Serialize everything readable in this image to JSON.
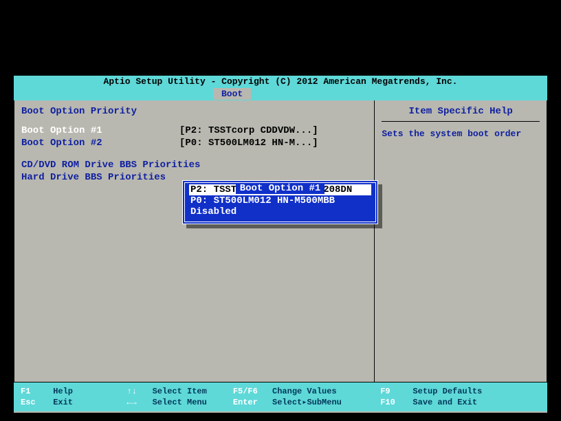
{
  "title": "Aptio Setup Utility - Copyright (C) 2012 American Megatrends, Inc.",
  "active_tab": "Boot",
  "left_panel": {
    "header": "Boot Option Priority",
    "options": [
      {
        "label": "Boot Option #1",
        "value": "[P2: TSSTcorp CDDVDW...]",
        "selected": true
      },
      {
        "label": "Boot Option #2",
        "value": "[P0: ST500LM012 HN-M...]",
        "selected": false
      }
    ],
    "submenus": [
      "CD/DVD ROM Drive BBS Priorities",
      "Hard Drive BBS Priorities"
    ]
  },
  "right_panel": {
    "header": "Item Specific Help",
    "text": "Sets the system boot order"
  },
  "popup": {
    "title": "Boot Option #1",
    "options": [
      {
        "label": "P2: TSSTcorp CDDVDW SN-208DN",
        "selected": true
      },
      {
        "label": "P0: ST500LM012 HN-M500MBB",
        "selected": false
      },
      {
        "label": "Disabled",
        "selected": false
      }
    ]
  },
  "footer": {
    "r1": {
      "k1": "F1",
      "l1": "Help",
      "k2": "↑↓",
      "l2": "Select Item",
      "k3": "F5/F6",
      "l3": "Change Values",
      "k4": "F9",
      "l4": "Setup Defaults"
    },
    "r2": {
      "k1": "Esc",
      "l1": "Exit",
      "k2": "←→",
      "l2": "Select Menu",
      "k3": "Enter",
      "l3": "Select▸SubMenu",
      "k4": "F10",
      "l4": "Save and Exit"
    }
  }
}
